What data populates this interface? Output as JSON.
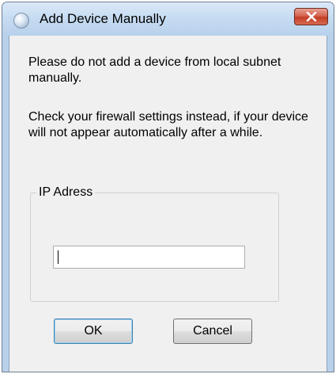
{
  "window": {
    "title": "Add Device Manually"
  },
  "dialog": {
    "message_1": "Please do not add a device from local subnet manually.",
    "message_2": "Check your firewall settings instead, if your device will not appear automatically after a while.",
    "ip_group_label": "IP Adress",
    "ip_value": ""
  },
  "buttons": {
    "ok_label": "OK",
    "cancel_label": "Cancel"
  },
  "icons": {
    "app": "app-icon",
    "close": "close-icon"
  },
  "colors": {
    "titlebar": "#c7dcf2",
    "close_button": "#c23d26",
    "client_background": "#f0f0f0"
  }
}
